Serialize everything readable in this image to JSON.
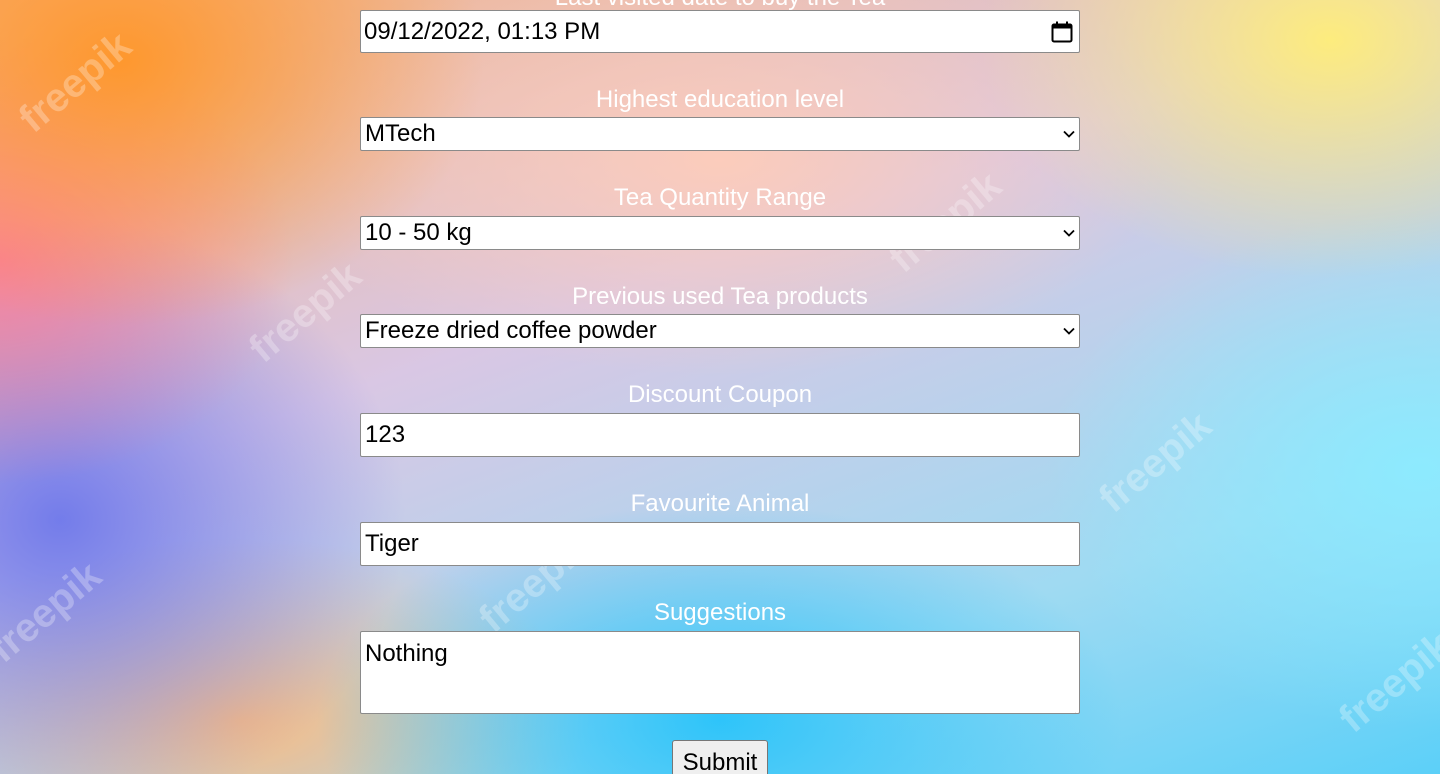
{
  "form": {
    "top_label": "Last visited date to buy the Tea",
    "datetime_value": "09/12/2022, 01:13 PM",
    "education": {
      "label": "Highest education level",
      "selected": "MTech"
    },
    "quantity": {
      "label": "Tea Quantity Range",
      "selected": "10 - 50 kg"
    },
    "previous_products": {
      "label": "Previous used Tea products",
      "selected": "Freeze dried coffee powder"
    },
    "coupon": {
      "label": "Discount Coupon",
      "value": "123"
    },
    "animal": {
      "label": "Favourite Animal",
      "value": "Tiger"
    },
    "suggestions": {
      "label": "Suggestions",
      "value": "Nothing"
    },
    "submit_label": "Submit"
  },
  "background": {
    "watermark_text": "freepik"
  }
}
